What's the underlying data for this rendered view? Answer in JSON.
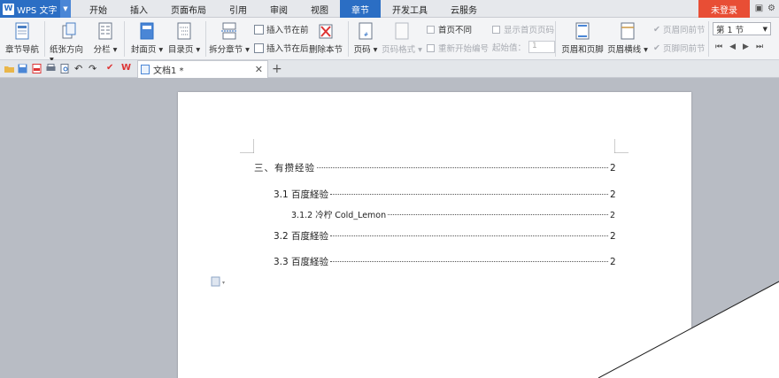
{
  "app": {
    "name": "WPS 文字",
    "logo_letter": "W"
  },
  "menu": {
    "tabs": [
      "开始",
      "插入",
      "页面布局",
      "引用",
      "审阅",
      "视图",
      "章节",
      "开发工具",
      "云服务"
    ],
    "active_tab": "章节",
    "login_label": "未登录"
  },
  "ribbon": {
    "section_nav": "章节导航",
    "paper_orientation": "纸张方向",
    "columns": "分栏",
    "cover_page": "封面页",
    "toc_page": "目录页",
    "split_section": "拆分章节",
    "insert_before": "插入节在前",
    "insert_after": "插入节在后",
    "delete_section": "删除本节",
    "page_number": "页码",
    "page_number_format": "页码格式",
    "first_page_diff": "首页不同",
    "show_first_page_number": "显示首页页码",
    "restart_numbering": "重新开始编号",
    "start_value_label": "起始值：",
    "start_value": "1",
    "header_footer": "页眉和页脚",
    "header_line": "页眉横线",
    "header_same_prev": "页眉同前节",
    "footer_same_prev": "页脚同前节",
    "section_select": "第 1 节"
  },
  "document": {
    "tab_title": "文档1 *",
    "toc": [
      {
        "text": "三、有攒经验",
        "page": "2"
      },
      {
        "text": "3.1 百度経验",
        "page": "2"
      },
      {
        "text": "3.1.2 冷柠 Cold_Lemon",
        "page": "2"
      },
      {
        "text": "3.2 百度経验",
        "page": "2"
      },
      {
        "text": "3.3 百度経验",
        "page": "2"
      }
    ]
  },
  "colors": {
    "accent": "#2b6ec4",
    "login": "#e84e35",
    "ribbon_bg": "#f3f4f6",
    "workspace": "#b8bcc4"
  }
}
